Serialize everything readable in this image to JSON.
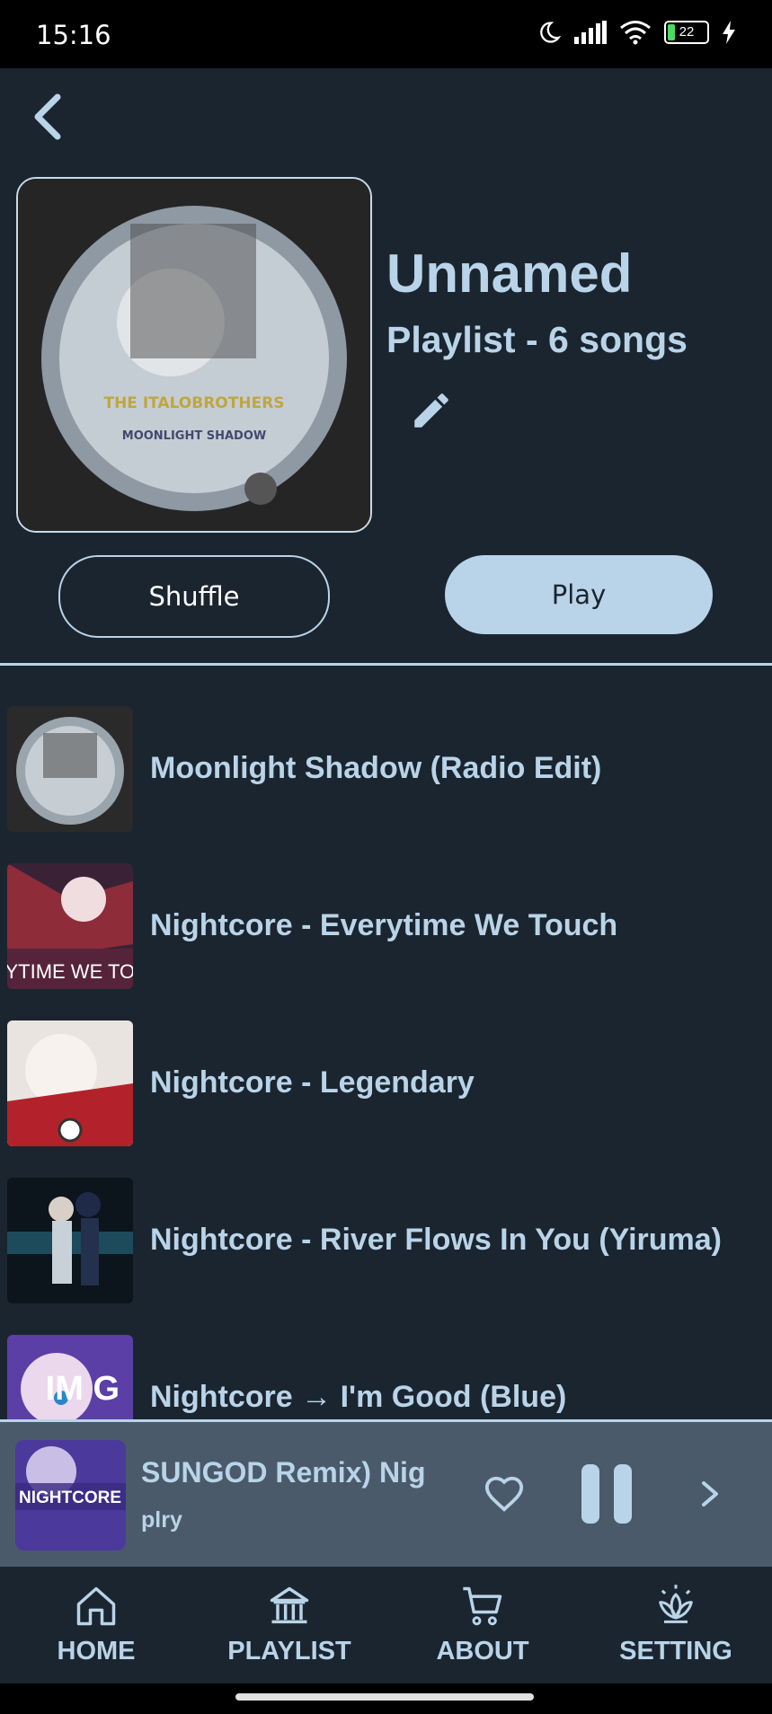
{
  "status_bar": {
    "time": "15:16",
    "battery": "22"
  },
  "playlist": {
    "title": "Unnamed",
    "subtitle": "Playlist - 6 songs",
    "cover_label_top": "THE ITALOBROTHERS",
    "cover_label_bottom": "MOONLIGHT SHADOW"
  },
  "actions": {
    "shuffle_label": "Shuffle",
    "play_label": "Play"
  },
  "songs": [
    {
      "title": "Moonlight Shadow (Radio Edit)"
    },
    {
      "title": "Nightcore - Everytime We Touch"
    },
    {
      "title": "Nightcore - Legendary"
    },
    {
      "title": "Nightcore - River Flows In You (Yiruma)"
    },
    {
      "title": "Nightcore → I'm Good (Blue)"
    }
  ],
  "thumb_text": {
    "song2": "RYTIME WE TOU",
    "song5": "IM G"
  },
  "now_playing": {
    "track": "SUNGOD Remix)    Nig",
    "artist": "plry",
    "art_label": "NIGHTCORE"
  },
  "nav": {
    "home": "HOME",
    "playlist": "PLAYLIST",
    "about": "ABOUT",
    "setting": "SETTING"
  },
  "colors": {
    "background": "#1b2530",
    "accent": "#b9d4e8",
    "player_bg": "#4a5a6a"
  }
}
